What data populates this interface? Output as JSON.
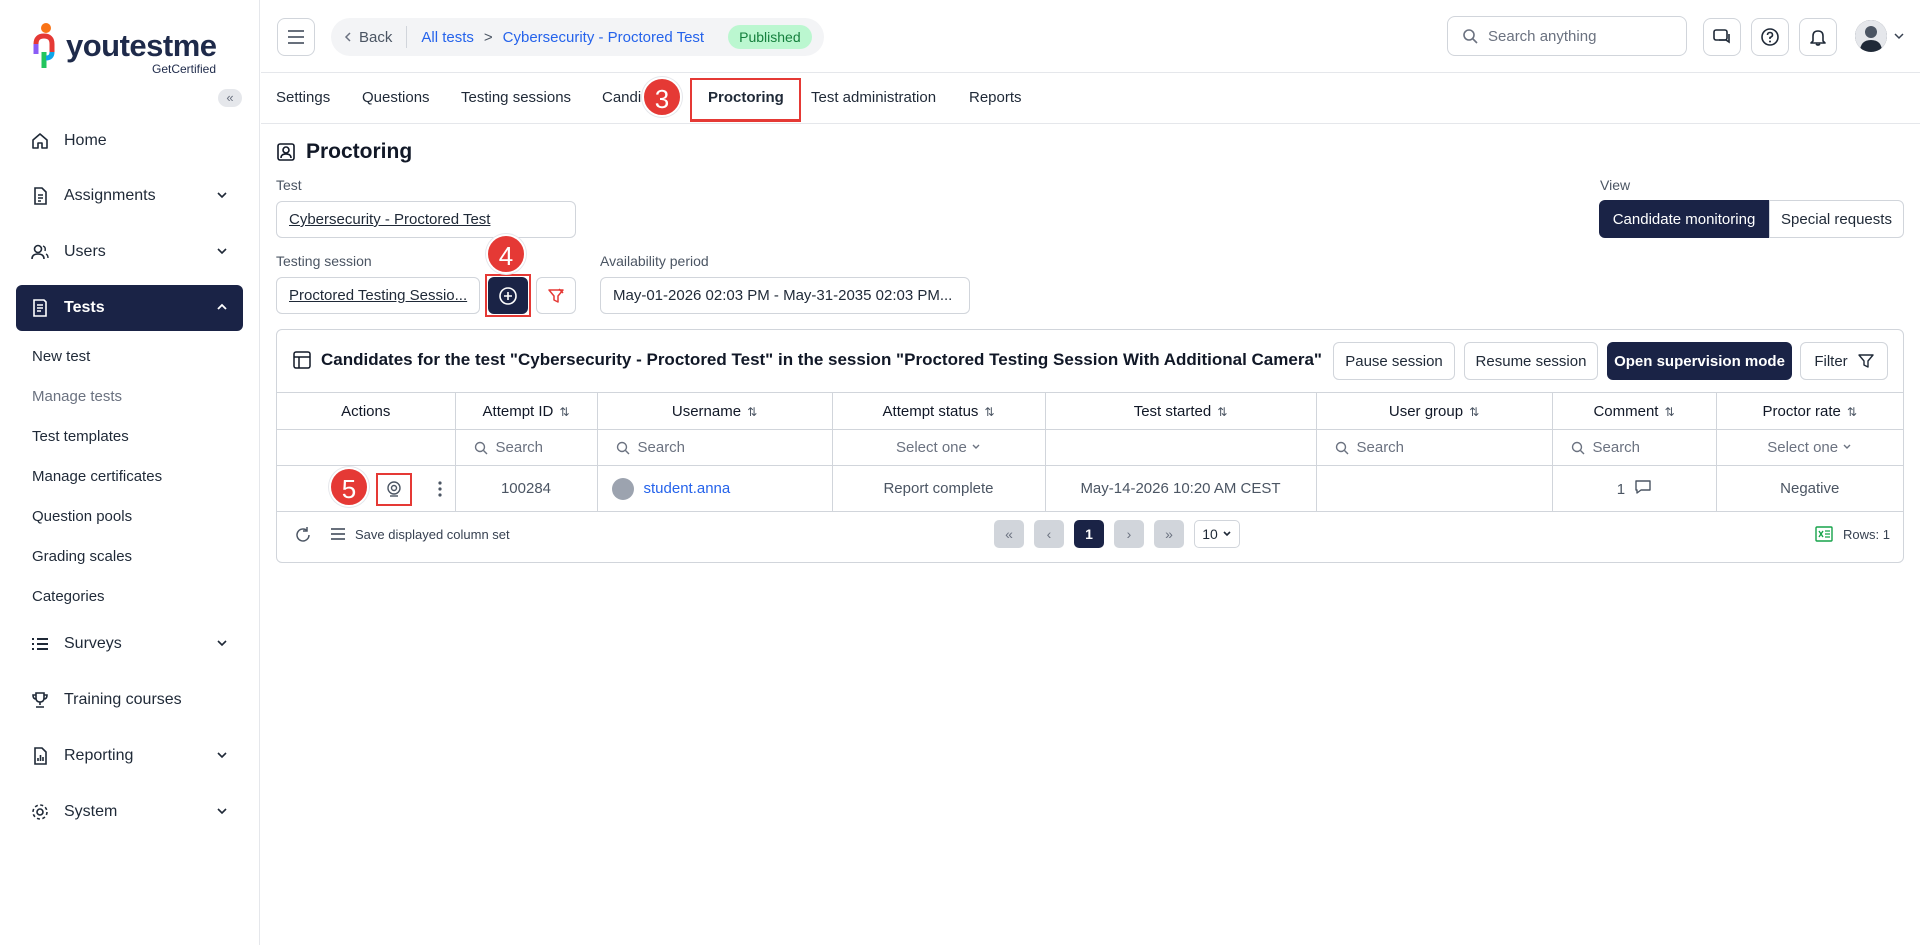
{
  "brand": {
    "name": "youtestme",
    "tagline": "GetCertified"
  },
  "sidebar": {
    "items": [
      {
        "label": "Home"
      },
      {
        "label": "Assignments"
      },
      {
        "label": "Users"
      },
      {
        "label": "Tests"
      },
      {
        "label": "Surveys"
      },
      {
        "label": "Training courses"
      },
      {
        "label": "Reporting"
      },
      {
        "label": "System"
      }
    ],
    "tests_sub": [
      {
        "label": "New test"
      },
      {
        "label": "Manage tests"
      },
      {
        "label": "Test templates"
      },
      {
        "label": "Manage certificates"
      },
      {
        "label": "Question pools"
      },
      {
        "label": "Grading scales"
      },
      {
        "label": "Categories"
      }
    ]
  },
  "header": {
    "back": "Back",
    "crumb_all": "All tests",
    "crumb_sep": ">",
    "crumb_current": "Cybersecurity - Proctored Test",
    "status": "Published",
    "search_placeholder": "Search anything"
  },
  "tabs": [
    {
      "label": "Settings"
    },
    {
      "label": "Questions"
    },
    {
      "label": "Testing sessions"
    },
    {
      "label": "Candid"
    },
    {
      "label": "Proctoring"
    },
    {
      "label": "Test administration"
    },
    {
      "label": "Reports"
    }
  ],
  "steps": {
    "s3": "3",
    "s4": "4",
    "s5": "5"
  },
  "page": {
    "title": "Proctoring",
    "test_label": "Test",
    "test_value": "Cybersecurity - Proctored Test",
    "session_label": "Testing session",
    "session_value": "Proctored Testing Sessio...",
    "availability_label": "Availability period",
    "availability_value": "May-01-2026 02:03 PM - May-31-2035 02:03 PM...",
    "view_label": "View",
    "view_options": [
      "Candidate monitoring",
      "Special requests"
    ]
  },
  "card": {
    "title": "Candidates for the test \"Cybersecurity - Proctored Test\" in the session \"Proctored Testing Session With Additional Camera\"",
    "buttons": {
      "pause": "Pause session",
      "resume": "Resume session",
      "supervise": "Open supervision mode",
      "filter": "Filter"
    }
  },
  "table": {
    "columns": [
      "Actions",
      "Attempt ID",
      "Username",
      "Attempt status",
      "Test started",
      "User group",
      "Comment",
      "Proctor rate"
    ],
    "filters": {
      "search": "Search",
      "select": "Select one"
    },
    "rows": [
      {
        "attempt_id": "100284",
        "username": "student.anna",
        "status": "Report complete",
        "started": "May-14-2026 10:20 AM CEST",
        "group": "",
        "comment": "1",
        "rate": "Negative"
      }
    ],
    "footer": {
      "save_set": "Save displayed column set",
      "page": "1",
      "page_size": "10",
      "rows": "Rows: 1"
    }
  },
  "colors": {
    "navy": "#1a2346",
    "highlight": "#e53935",
    "link": "#2563eb",
    "published_bg": "#bbf7d0"
  }
}
